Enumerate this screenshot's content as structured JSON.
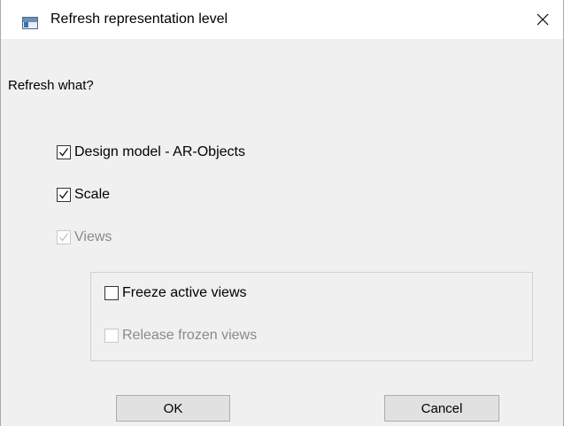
{
  "window": {
    "title": "Refresh representation level",
    "icon": "application-window-icon",
    "close_icon": "close-icon"
  },
  "prompt": "Refresh what?",
  "options": {
    "design_model": {
      "label": "Design model - AR-Objects",
      "checked": true,
      "enabled": true
    },
    "scale": {
      "label": "Scale",
      "checked": true,
      "enabled": true
    },
    "views": {
      "label": "Views",
      "checked": true,
      "enabled": false
    }
  },
  "views_group": {
    "freeze_active_views": {
      "label": "Freeze active views",
      "checked": false,
      "enabled": true
    },
    "release_frozen_views": {
      "label": "Release frozen views",
      "checked": false,
      "enabled": false
    }
  },
  "buttons": {
    "ok": "OK",
    "cancel": "Cancel"
  },
  "colors": {
    "dialog_background": "#f0f0f0",
    "titlebar_background": "#ffffff",
    "disabled_text": "#8a8a8a",
    "button_background": "#e1e1e1"
  }
}
